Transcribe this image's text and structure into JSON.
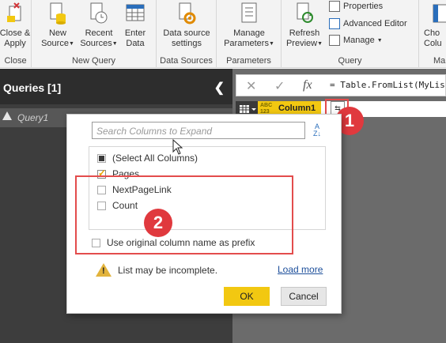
{
  "ribbon": {
    "close_apply": "Close &\nApply",
    "close_group": "Close",
    "new_source": "New\nSource",
    "recent_sources": "Recent\nSources",
    "enter_data": "Enter\nData",
    "new_query_group": "New Query",
    "data_source_settings": "Data source\nsettings",
    "data_sources_group": "Data Sources",
    "manage_parameters": "Manage\nParameters",
    "parameters_group": "Parameters",
    "refresh_preview": "Refresh\nPreview",
    "properties": "Properties",
    "advanced_editor": "Advanced Editor",
    "manage": "Manage",
    "query_group": "Query",
    "choose_columns": "Cho\nColu",
    "ma_group": "Ma"
  },
  "queries": {
    "title": "Queries [1]",
    "items": [
      {
        "label": "Query1"
      }
    ]
  },
  "formula_bar": {
    "formula": "= Table.FromList(MyLis"
  },
  "grid": {
    "column_type": "ABC\n123",
    "column_name": "Column1"
  },
  "dialog": {
    "search_placeholder": "Search Columns to Expand",
    "columns": [
      {
        "label": "(Select All Columns)",
        "state": "indeterminate"
      },
      {
        "label": "Pages",
        "state": "checked"
      },
      {
        "label": "NextPageLink",
        "state": "unchecked"
      },
      {
        "label": "Count",
        "state": "unchecked"
      }
    ],
    "prefix_label": "Use original column name as prefix",
    "warning": "List may be incomplete.",
    "load_more": "Load more",
    "ok": "OK",
    "cancel": "Cancel"
  },
  "annotations": {
    "badge1": "1",
    "badge2": "2"
  },
  "colors": {
    "accent": "#f2c811",
    "annotation_red": "#e0393e",
    "pane_dark": "#3d3d3d"
  }
}
